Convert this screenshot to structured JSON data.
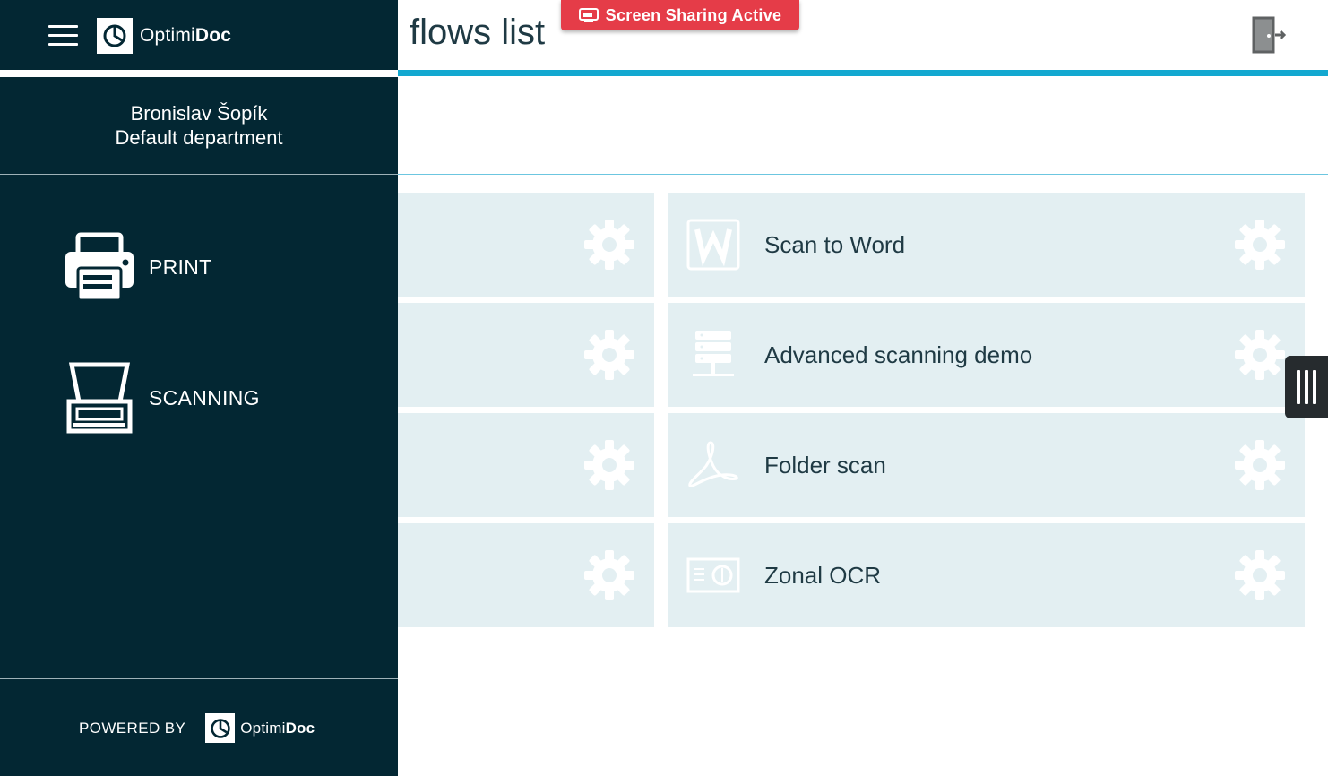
{
  "brand": {
    "name_prefix": "Optimi",
    "name_bold": "Doc"
  },
  "user": {
    "name": "Bronislav Šopík",
    "department": "Default department"
  },
  "nav": {
    "items": [
      {
        "label": "PRINT",
        "icon": "printer-icon"
      },
      {
        "label": "SCANNING",
        "icon": "scanner-icon"
      }
    ]
  },
  "footer": {
    "powered_by": "POWERED BY"
  },
  "header": {
    "title": "flows list"
  },
  "overlay": {
    "screen_sharing": "Screen Sharing Active"
  },
  "flows": [
    {
      "label": "Scan to Word",
      "icon": "word-icon"
    },
    {
      "label": "Advanced scanning demo",
      "icon": "server-icon"
    },
    {
      "label": "Folder scan",
      "icon": "pdf-icon"
    },
    {
      "label": "Zonal OCR",
      "icon": "ocr-icon"
    }
  ],
  "colors": {
    "sidebar_bg": "#032733",
    "accent_blue": "#13a8d0",
    "tile_bg": "#e3eff2",
    "badge_red": "#e53c48"
  }
}
